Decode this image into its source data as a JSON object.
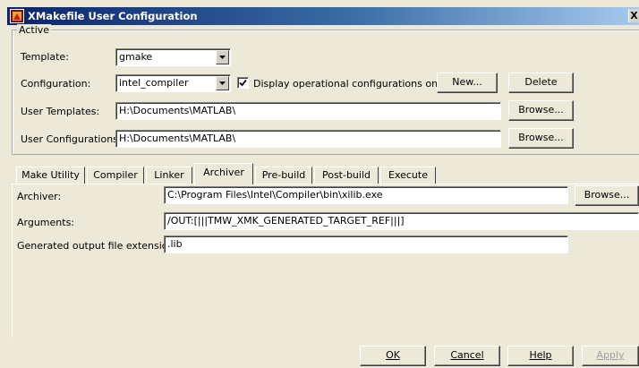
{
  "window": {
    "title": "XMakefile User Configuration",
    "close_glyph": "X"
  },
  "active_group": {
    "legend": "Active",
    "template_label": "Template:",
    "template_value": "gmake",
    "configuration_label": "Configuration:",
    "configuration_value": "intel_compiler",
    "display_operational_label": "Display operational configurations only",
    "display_operational_checked": true,
    "new_button": "New...",
    "delete_button": "Delete",
    "user_templates_label": "User Templates:",
    "user_templates_value": "H:\\Documents\\MATLAB\\",
    "user_configurations_label": "User Configurations:",
    "user_configurations_value": "H:\\Documents\\MATLAB\\",
    "browse_button": "Browse..."
  },
  "tabs": [
    {
      "label": "Make Utility"
    },
    {
      "label": "Compiler"
    },
    {
      "label": "Linker"
    },
    {
      "label": "Archiver"
    },
    {
      "label": "Pre-build"
    },
    {
      "label": "Post-build"
    },
    {
      "label": "Execute"
    }
  ],
  "active_tab": "Archiver",
  "archiver": {
    "archiver_label": "Archiver:",
    "archiver_value": "C:\\Program Files\\Intel\\Compiler\\bin\\xilib.exe",
    "browse_button": "Browse...",
    "arguments_label": "Arguments:",
    "arguments_value": "/OUT:[|||TMW_XMK_GENERATED_TARGET_REF|||]",
    "extension_label": "Generated output file extension:",
    "extension_value": ".lib"
  },
  "footer": {
    "ok_button": "OK",
    "cancel_button": "Cancel",
    "help_button": "Help",
    "apply_button": "Apply"
  }
}
